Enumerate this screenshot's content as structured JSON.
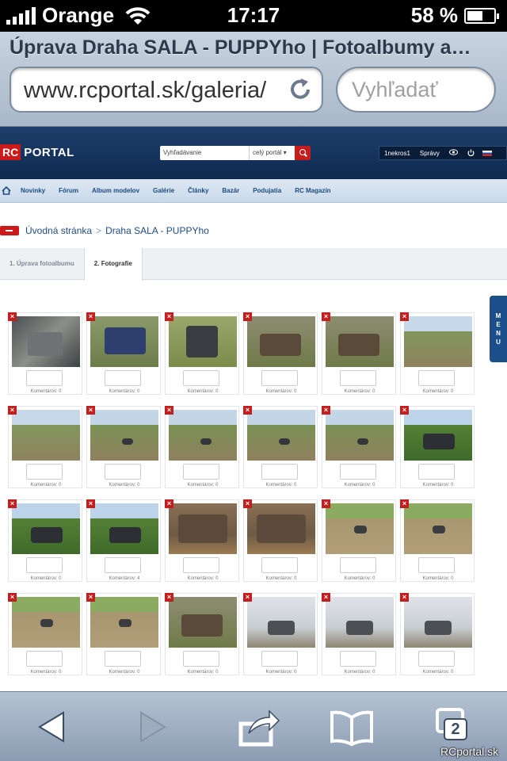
{
  "status": {
    "carrier": "Orange",
    "time": "17:17",
    "battery": "58 %",
    "battery_level": 0.58
  },
  "browser": {
    "page_title": "Úprava Draha SALA - PUPPYho | Fotoalbumy a…",
    "url": "www.rcportal.sk/galeria/",
    "search_placeholder": "Vyhľadať",
    "tab_count": "2"
  },
  "site": {
    "logo_rc": "RC",
    "logo_portal": "PORTAL",
    "search_placeholder": "Vyhľadávanie",
    "search_scope": "celý portál ▾",
    "user": "1nekros1",
    "messages": "Správy",
    "nav": [
      "Novinky",
      "Fórum",
      "Album modelov",
      "Galérie",
      "Články",
      "Bazár",
      "Podujatia",
      "RC Magazín"
    ],
    "nav_active": "Galérie",
    "breadcrumb": [
      "Úvodná stránka",
      "Draha SALA - PUPPYho"
    ],
    "breadcrumb_sep": ">",
    "tabs": [
      "1. Úprava fotoalbumu",
      "2. Fotografie"
    ],
    "menu_label": [
      "M",
      "E",
      "N",
      "U"
    ]
  },
  "photos": [
    {
      "comments": "Komentárov: 0",
      "scene": "workbench"
    },
    {
      "comments": "Komentárov: 0",
      "scene": "truck-grass"
    },
    {
      "comments": "Komentárov: 0",
      "scene": "truck-upside"
    },
    {
      "comments": "Komentárov: 0",
      "scene": "truck-dirt"
    },
    {
      "comments": "Komentárov: 0",
      "scene": "truck-dirt"
    },
    {
      "comments": "Komentárov: 0",
      "scene": "track"
    },
    {
      "comments": "Komentárov: 0",
      "scene": "track"
    },
    {
      "comments": "Komentárov: 0",
      "scene": "track-car"
    },
    {
      "comments": "Komentárov: 0",
      "scene": "track-car"
    },
    {
      "comments": "Komentárov: 0",
      "scene": "track-car"
    },
    {
      "comments": "Komentárov: 0",
      "scene": "track-car"
    },
    {
      "comments": "Komentárov: 0",
      "scene": "people"
    },
    {
      "comments": "Komentárov: 0",
      "scene": "people"
    },
    {
      "comments": "Komentárov: 4",
      "scene": "people"
    },
    {
      "comments": "Komentárov: 0",
      "scene": "pile"
    },
    {
      "comments": "Komentárov: 0",
      "scene": "pile"
    },
    {
      "comments": "Komentárov: 0",
      "scene": "dirt-car"
    },
    {
      "comments": "Komentárov: 0",
      "scene": "dirt-car"
    },
    {
      "comments": "Komentárov: 0",
      "scene": "dirt-car"
    },
    {
      "comments": "Komentárov: 0",
      "scene": "dirt-car"
    },
    {
      "comments": "Komentárov: 0",
      "scene": "truck-dirt"
    },
    {
      "comments": "Komentárov: 0",
      "scene": "snow"
    },
    {
      "comments": "Komentárov: 0",
      "scene": "snow"
    },
    {
      "comments": "Komentárov: 0",
      "scene": "snow"
    }
  ],
  "watermark": "RCportal.sk"
}
